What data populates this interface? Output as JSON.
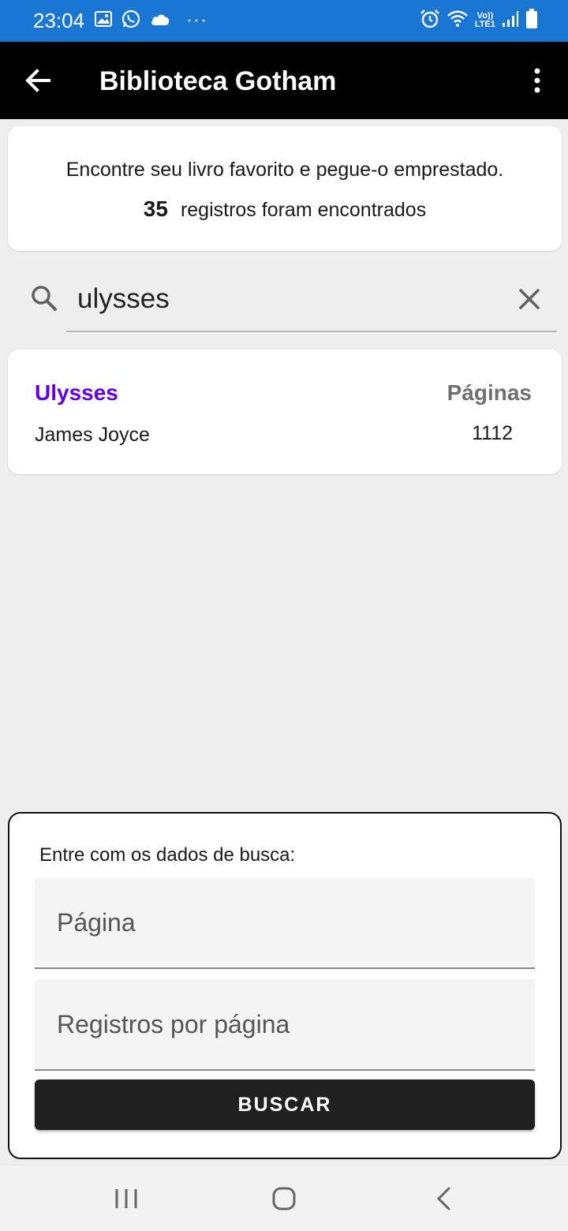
{
  "status_bar": {
    "time": "23:04",
    "network_label_top": "Vo))",
    "network_label_bottom": "LTE1",
    "more": "···",
    "icons_left": [
      "gallery-icon",
      "whatsapp-icon",
      "cloud-icon",
      "more-icon"
    ],
    "icons_right": [
      "alarm-icon",
      "wifi-icon",
      "lte-icon",
      "signal-icon",
      "battery-icon"
    ]
  },
  "app_bar": {
    "title": "Biblioteca Gotham",
    "back_icon": "arrow-left-icon",
    "menu_icon": "more-vert-icon"
  },
  "info_card": {
    "text": "Encontre seu livro favorito e pegue-o emprestado.",
    "count": "35",
    "count_suffix": "registros foram encontrados"
  },
  "search": {
    "value": "ulysses",
    "search_icon": "search-icon",
    "clear_icon": "close-icon"
  },
  "results": [
    {
      "title": "Ulysses",
      "author": "James Joyce",
      "pages_label": "Páginas",
      "pages": "1112"
    }
  ],
  "search_sheet": {
    "title": "Entre com os dados de busca:",
    "page_placeholder": "Página",
    "records_placeholder": "Registros por página",
    "button_label": "BUSCAR"
  },
  "nav_bar": {
    "icons": [
      "recents-icon",
      "home-icon",
      "back-icon"
    ]
  },
  "colors": {
    "status_bar": "#1976d2",
    "app_bar": "#000000",
    "accent": "#6200ee",
    "button": "#212121",
    "background": "#eeeeee"
  }
}
